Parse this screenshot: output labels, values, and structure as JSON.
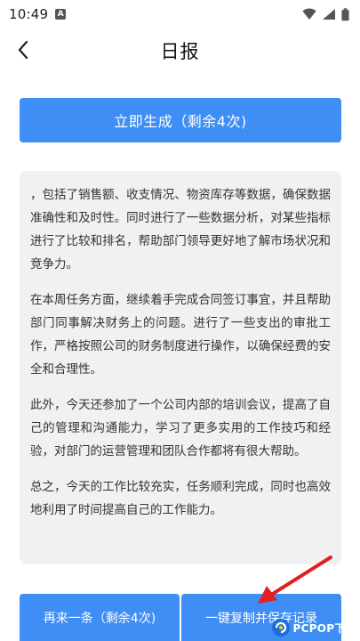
{
  "status_bar": {
    "time": "10:49",
    "notification_badge": "A",
    "icons": [
      "wifi-icon",
      "signal-icon",
      "battery-icon"
    ]
  },
  "header": {
    "title": "日报"
  },
  "generate_button": {
    "label": "立即生成（剩余4次)"
  },
  "report": {
    "paragraphs": [
      "，包括了销售额、收支情况、物资库存等数据，确保数据准确性和及时性。同时进行了一些数据分析，对某些指标进行了比较和排名，帮助部门领导更好地了解市场状况和竞争力。",
      "在本周任务方面，继续着手完成合同签订事宜，并且帮助部门同事解决财务上的问题。进行了一些支出的审批工作，严格按照公司的财务制度进行操作，以确保经费的安全和合理性。",
      "此外，今天还参加了一个公司内部的培训会议，提高了自己的管理和沟通能力，学习了更多实用的工作技巧和经验，对部门的运营管理和团队合作都将有很大帮助。",
      "总之，今天的工作比较充实，任务顺利完成，同时也高效地利用了时间提高自己的工作能力。"
    ]
  },
  "bottom_actions": {
    "retry_label": "再来一条（剩余4次)",
    "copy_label": "一键复制并保存记录"
  },
  "watermark": {
    "text": "PCPOP下载"
  },
  "colors": {
    "accent": "#3f8ef5",
    "report_bg": "#f1f1f1",
    "arrow": "#e02020"
  }
}
